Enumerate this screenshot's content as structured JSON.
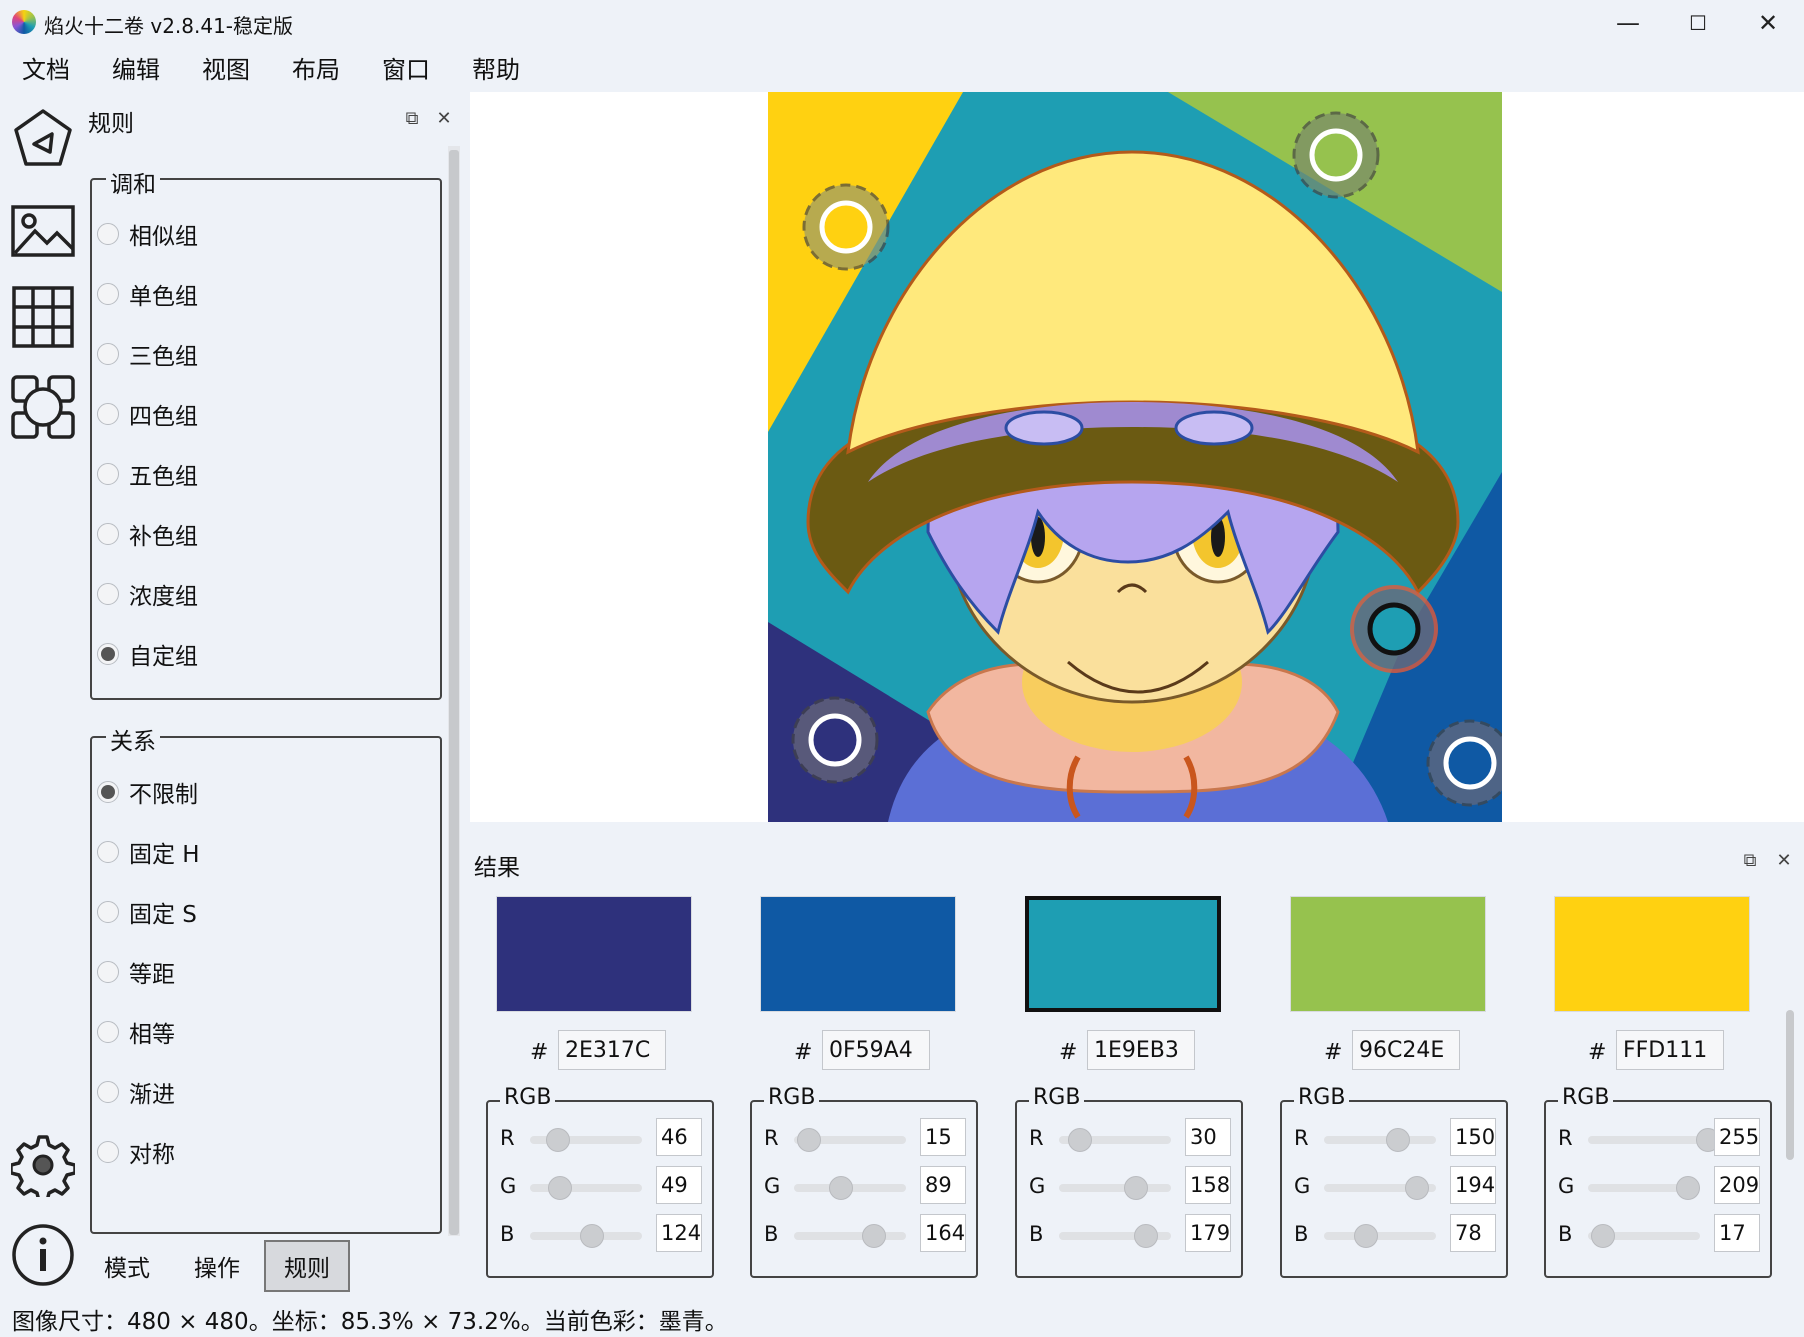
{
  "window": {
    "title": "焰火十二卷 v2.8.41-稳定版",
    "minimize": "—",
    "maximize": "☐",
    "close": "✕"
  },
  "menu": [
    "文档",
    "编辑",
    "视图",
    "布局",
    "窗口",
    "帮助"
  ],
  "toolbar": {
    "icons": [
      "triangle-wheel-icon",
      "image-icon",
      "grid-icon",
      "shapes-icon",
      "gear-icon",
      "info-icon"
    ]
  },
  "rule_panel": {
    "title": "规则",
    "harmony": {
      "legend": "调和",
      "options": [
        "相似组",
        "单色组",
        "三色组",
        "四色组",
        "五色组",
        "补色组",
        "浓度组",
        "自定组"
      ],
      "selected": 7
    },
    "relation": {
      "legend": "关系",
      "options": [
        "不限制",
        "固定 H",
        "固定 S",
        "等距",
        "相等",
        "渐进",
        "对称"
      ],
      "selected": 0
    },
    "tabs": [
      "模式",
      "操作",
      "规则"
    ],
    "active_tab": 2
  },
  "results": {
    "title": "结果",
    "hash": "#",
    "rgb_label": "RGB",
    "channel_labels": [
      "R",
      "G",
      "B"
    ],
    "colors": [
      {
        "hex": "2E317C",
        "swatch": "#2E317C",
        "r": "46",
        "g": "49",
        "b": "124",
        "selected": false
      },
      {
        "hex": "0F59A4",
        "swatch": "#0F59A4",
        "r": "15",
        "g": "89",
        "b": "164",
        "selected": false
      },
      {
        "hex": "1E9EB3",
        "swatch": "#1E9EB3",
        "r": "30",
        "g": "158",
        "b": "179",
        "selected": true
      },
      {
        "hex": "96C24E",
        "swatch": "#96C24E",
        "r": "150",
        "g": "194",
        "b": "78",
        "selected": false
      },
      {
        "hex": "FFD111",
        "swatch": "#FFD111",
        "r": "255",
        "g": "209",
        "b": "17",
        "selected": false
      }
    ]
  },
  "status": "图像尺寸：480 × 480。坐标：85.3% × 73.2%。当前色彩：墨青。"
}
